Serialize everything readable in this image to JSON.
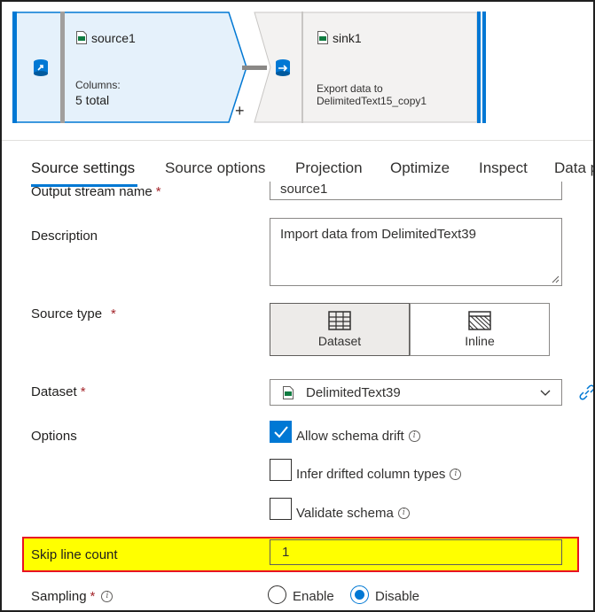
{
  "flow": {
    "source": {
      "name": "source1",
      "columns_label": "Columns:",
      "columns_value": "5 total"
    },
    "sink": {
      "name": "sink1",
      "desc_line1": "Export data to",
      "desc_line2": "DelimitedText15_copy1"
    },
    "add_symbol": "+"
  },
  "tabs": [
    {
      "label": "Source settings",
      "active": true
    },
    {
      "label": "Source options",
      "active": false
    },
    {
      "label": "Projection",
      "active": false
    },
    {
      "label": "Optimize",
      "active": false
    },
    {
      "label": "Inspect",
      "active": false
    },
    {
      "label": "Data p",
      "active": false
    }
  ],
  "form": {
    "output_stream": {
      "label": "Output stream name",
      "required_mark": "*",
      "value": "source1"
    },
    "description": {
      "label": "Description",
      "value": "Import data from DelimitedText39"
    },
    "source_type": {
      "label": "Source type",
      "required_mark": "*",
      "options": [
        {
          "label": "Dataset",
          "selected": true
        },
        {
          "label": "Inline",
          "selected": false
        }
      ]
    },
    "dataset": {
      "label": "Dataset",
      "required_mark": "*",
      "value": "DelimitedText39"
    },
    "options": {
      "label": "Options",
      "checkboxes": [
        {
          "label": "Allow schema drift",
          "checked": true,
          "info": "i"
        },
        {
          "label": "Infer drifted column types",
          "checked": false,
          "info": "i"
        },
        {
          "label": "Validate schema",
          "checked": false,
          "info": "i"
        }
      ]
    },
    "skip_line_count": {
      "label": "Skip line count",
      "value": "1"
    },
    "sampling": {
      "label": "Sampling",
      "required_mark": "*",
      "info": "i",
      "options": [
        {
          "label": "Enable",
          "selected": false
        },
        {
          "label": "Disable",
          "selected": true
        }
      ]
    }
  },
  "colors": {
    "accent": "#0078d4",
    "highlight": "#ffff00",
    "highlight_border": "#e81123",
    "required": "#a4262c"
  },
  "icons": [
    "csv-file-icon",
    "dataset-source-icon",
    "dataset-sink-icon",
    "table-grid-icon",
    "hatched-grid-icon",
    "chevron-down-icon",
    "link-icon",
    "info-icon",
    "checkmark-icon"
  ]
}
